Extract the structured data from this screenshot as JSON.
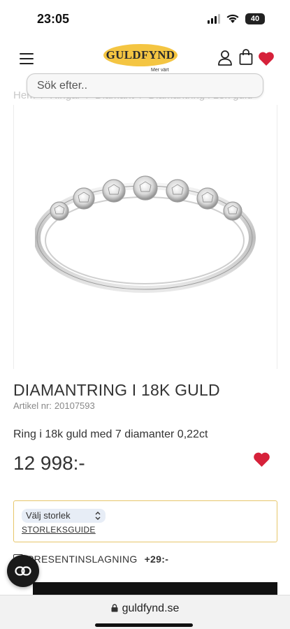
{
  "status_bar": {
    "time": "23:05",
    "battery": "40"
  },
  "header": {
    "logo_text": "GULDFYND",
    "logo_tagline": "Mer värt",
    "icons": [
      "menu-icon",
      "user-icon",
      "shopping-bag-icon",
      "heart-icon"
    ]
  },
  "search": {
    "placeholder": "Sök efter.."
  },
  "breadcrumb": [
    "Hem",
    "/",
    "Ringar",
    "/",
    "Diamant",
    "/",
    "Diamantring i 18k guld"
  ],
  "product": {
    "title": "DIAMANTRING I 18K GULD",
    "article_label": "Artikel nr:",
    "article_number": "20107593",
    "description": "Ring i 18k guld med 7 diamanter 0,22ct",
    "price": "12 998:-"
  },
  "options": {
    "size_select": "Välj storlek",
    "size_guide": "STORLEKSGUIDE",
    "gift_wrap_label": "PRESENTINSLAGNING",
    "gift_wrap_price": "+29:-"
  },
  "browser": {
    "url": "guldfynd.se"
  },
  "colors": {
    "brand_yellow": "#f4c542",
    "heart_red": "#d6213a",
    "select_bg": "#e7edf6",
    "border_gold": "#e7c66a"
  }
}
